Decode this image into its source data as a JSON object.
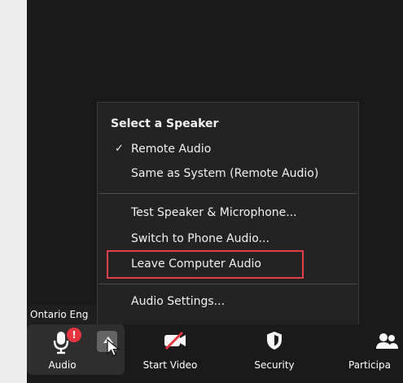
{
  "meeting": {
    "participant_name": "Ontario Eng"
  },
  "audio_menu": {
    "heading": "Select a Speaker",
    "checkmark": "✓",
    "items": [
      "Remote Audio",
      "Same as System (Remote Audio)",
      "Test Speaker & Microphone...",
      "Switch to Phone Audio...",
      "Leave Computer Audio",
      "Audio Settings..."
    ],
    "highlight_color": "#e0404a"
  },
  "toolbar": {
    "audio_label": "Audio",
    "audio_badge": "!",
    "video_label": "Start Video",
    "security_label": "Security",
    "participants_label": "Participa"
  },
  "icons": {
    "audio": "microphone-icon",
    "caret": "chevron-up-icon",
    "video": "video-camera-off-icon",
    "security": "shield-icon",
    "participants": "participants-icon",
    "cursor": "mouse-pointer-icon"
  },
  "colors": {
    "background": "#ececec",
    "dark_panel": "#1a1a1a",
    "alert": "#e7343f",
    "muted_slash": "#e7343f"
  }
}
